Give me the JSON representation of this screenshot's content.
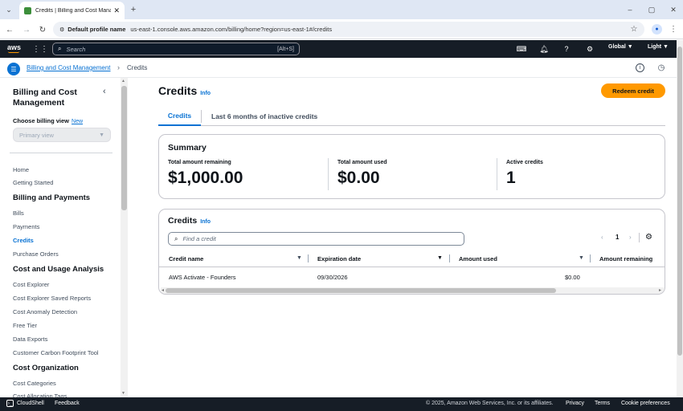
{
  "browser": {
    "tab_title": "Credits | Billing and Cost Mana",
    "profile": "Default profile name",
    "url": "us-east-1.console.aws.amazon.com/billing/home?region=us-east-1#/credits"
  },
  "topbar": {
    "logo": "aws",
    "search_placeholder": "Search",
    "shortcut": "[Alt+S]",
    "region": "Global ▼",
    "theme": "Light ▼"
  },
  "breadcrumb": {
    "parent": "Billing and Cost Management",
    "current": "Credits"
  },
  "sidebar": {
    "title": "Billing and Cost Management",
    "billing_view_label": "Choose billing view",
    "billing_view_new": "New",
    "billing_view_value": "Primary view",
    "items": [
      {
        "label": "Home",
        "type": "link"
      },
      {
        "label": "Getting Started",
        "type": "link"
      },
      {
        "label": "Billing and Payments",
        "type": "head"
      },
      {
        "label": "Bills",
        "type": "link"
      },
      {
        "label": "Payments",
        "type": "link"
      },
      {
        "label": "Credits",
        "type": "active"
      },
      {
        "label": "Purchase Orders",
        "type": "link"
      },
      {
        "label": "Cost and Usage Analysis",
        "type": "head"
      },
      {
        "label": "Cost Explorer",
        "type": "link"
      },
      {
        "label": "Cost Explorer Saved Reports",
        "type": "link"
      },
      {
        "label": "Cost Anomaly Detection",
        "type": "link"
      },
      {
        "label": "Free Tier",
        "type": "link"
      },
      {
        "label": "Data Exports",
        "type": "link"
      },
      {
        "label": "Customer Carbon Footprint Tool",
        "type": "link"
      },
      {
        "label": "Cost Organization",
        "type": "head"
      },
      {
        "label": "Cost Categories",
        "type": "link"
      },
      {
        "label": "Cost Allocation Tags",
        "type": "link"
      }
    ]
  },
  "main": {
    "title": "Credits",
    "info": "Info",
    "redeem_button": "Redeem credit",
    "tabs": [
      "Credits",
      "Last 6 months of inactive credits"
    ],
    "summary": {
      "title": "Summary",
      "remaining_label": "Total amount remaining",
      "remaining_value": "$1,000.00",
      "used_label": "Total amount used",
      "used_value": "$0.00",
      "active_label": "Active credits",
      "active_value": "1"
    },
    "credits_table": {
      "title": "Credits",
      "info": "Info",
      "search_placeholder": "Find a credit",
      "page": "1",
      "columns": [
        "Credit name",
        "Expiration date",
        "Amount used",
        "Amount remaining"
      ],
      "rows": [
        {
          "name": "AWS Activate - Founders",
          "expiration": "09/30/2026",
          "used": "$0.00"
        }
      ]
    }
  },
  "footer": {
    "cloudshell": "CloudShell",
    "feedback": "Feedback",
    "copyright": "© 2025, Amazon Web Services, Inc. or its affiliates.",
    "privacy": "Privacy",
    "terms": "Terms",
    "cookies": "Cookie preferences"
  }
}
